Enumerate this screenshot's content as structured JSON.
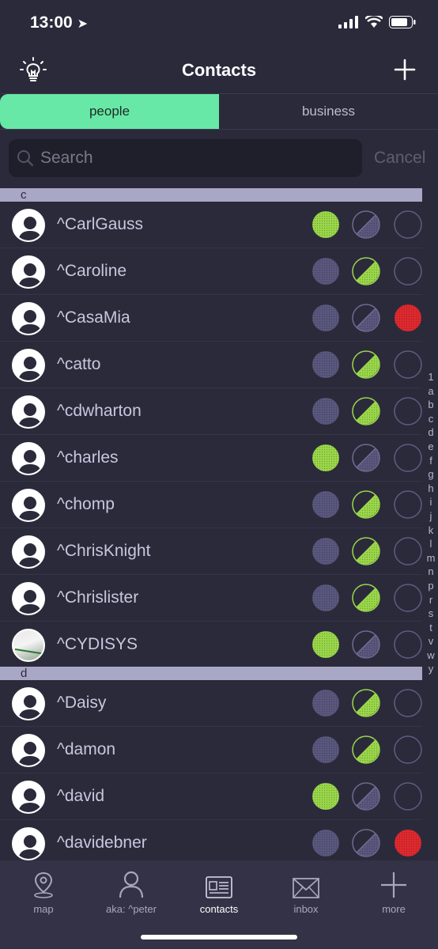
{
  "status": {
    "time": "13:00"
  },
  "nav": {
    "title": "Contacts"
  },
  "segments": [
    {
      "label": "people",
      "active": true
    },
    {
      "label": "business",
      "active": false
    }
  ],
  "search": {
    "placeholder": "Search",
    "cancel_label": "Cancel"
  },
  "sections": [
    {
      "letter": "c",
      "contacts": [
        {
          "name": "^CarlGauss",
          "states": [
            "green",
            "half-gray",
            "empty"
          ]
        },
        {
          "name": "^Caroline",
          "states": [
            "gray",
            "half-green",
            "empty"
          ]
        },
        {
          "name": "^CasaMia",
          "states": [
            "gray",
            "half-gray",
            "red"
          ]
        },
        {
          "name": "^catto",
          "states": [
            "gray",
            "half-green",
            "empty"
          ]
        },
        {
          "name": "^cdwharton",
          "states": [
            "gray",
            "half-green",
            "empty"
          ]
        },
        {
          "name": "^charles",
          "states": [
            "green",
            "half-gray",
            "empty"
          ]
        },
        {
          "name": "^chomp",
          "states": [
            "gray",
            "half-green",
            "empty"
          ]
        },
        {
          "name": "^ChrisKnight",
          "states": [
            "gray",
            "half-green",
            "empty"
          ]
        },
        {
          "name": "^Chrislister",
          "states": [
            "gray",
            "half-green",
            "empty"
          ]
        },
        {
          "name": "^CYDISYS",
          "states": [
            "green",
            "half-gray",
            "empty"
          ],
          "photo": true
        }
      ]
    },
    {
      "letter": "d",
      "contacts": [
        {
          "name": "^Daisy",
          "states": [
            "gray",
            "half-green",
            "empty"
          ]
        },
        {
          "name": "^damon",
          "states": [
            "gray",
            "half-green",
            "empty"
          ]
        },
        {
          "name": "^david",
          "states": [
            "green",
            "half-gray",
            "empty"
          ]
        },
        {
          "name": "^davidebner",
          "states": [
            "gray",
            "half-gray",
            "red"
          ]
        }
      ]
    }
  ],
  "index_letters": [
    "1",
    "a",
    "b",
    "c",
    "d",
    "e",
    "f",
    "g",
    "h",
    "i",
    "j",
    "k",
    "l",
    "m",
    "n",
    "p",
    "r",
    "s",
    "t",
    "v",
    "w",
    "y"
  ],
  "tabs": [
    {
      "label": "map",
      "icon": "map-pin-icon"
    },
    {
      "label": "aka: ^peter",
      "icon": "person-icon"
    },
    {
      "label": "contacts",
      "icon": "contact-card-icon",
      "active": true
    },
    {
      "label": "inbox",
      "icon": "envelope-icon"
    },
    {
      "label": "more",
      "icon": "plus-icon"
    }
  ],
  "colors": {
    "accent": "#68e8a6",
    "green": "#9bd84a",
    "gray": "#5a587e",
    "red": "#e02a2f",
    "background": "#2b2a3b"
  }
}
